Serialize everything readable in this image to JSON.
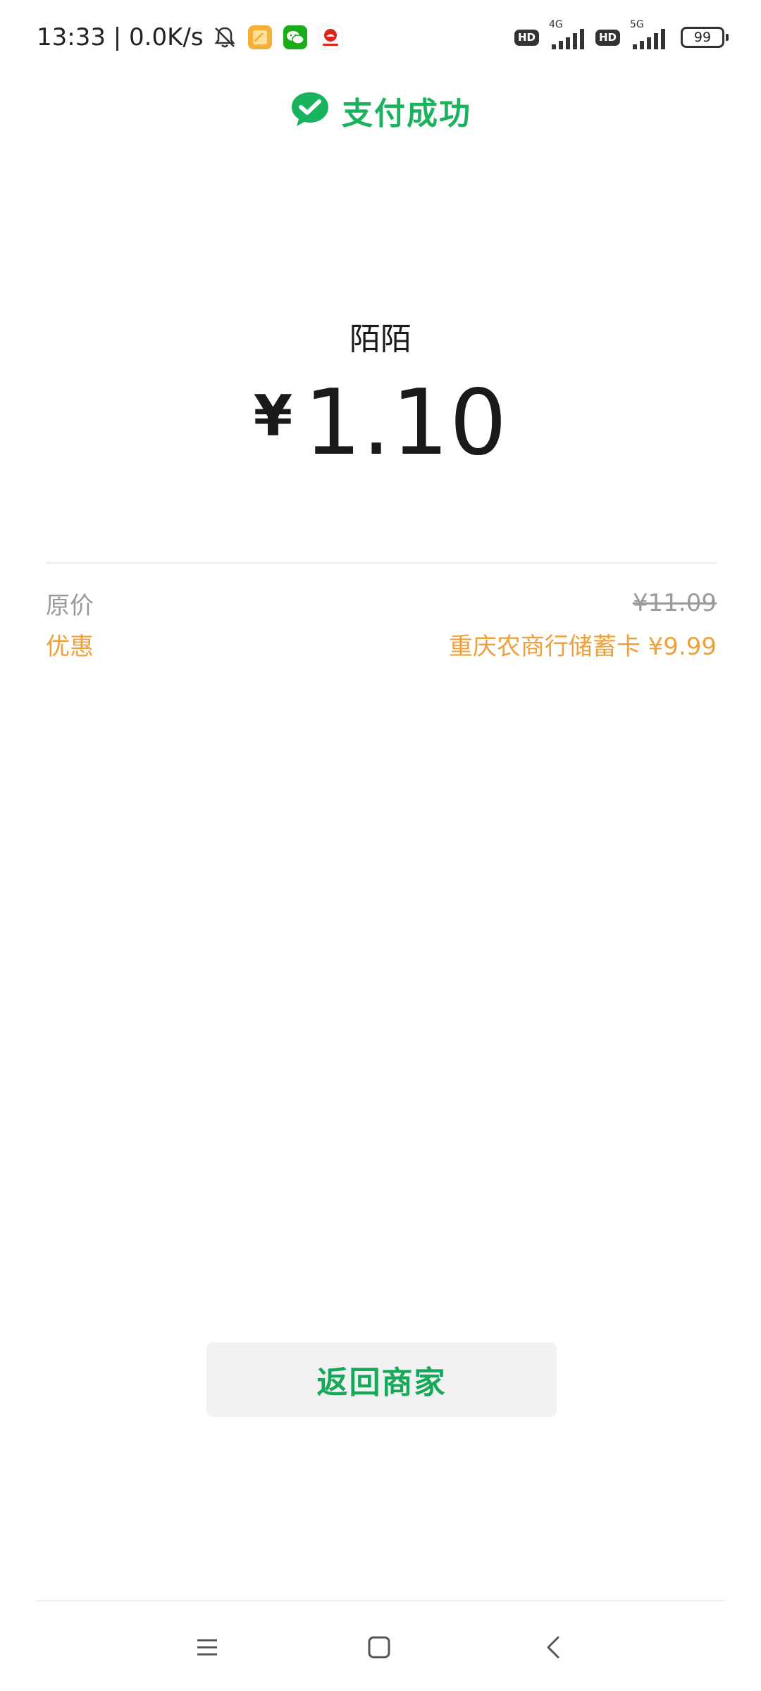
{
  "status_bar": {
    "time_and_speed": "13:33 | 0.0K/s",
    "network_1": "4G",
    "network_2": "5G",
    "hd_label": "HD",
    "battery": "99",
    "icons": [
      "silent-bell-icon",
      "notes-app-icon",
      "wechat-icon",
      "app-notification-icon",
      "signal-icon",
      "battery-icon"
    ]
  },
  "header": {
    "title": "支付成功",
    "icon": "wechat-pay-check-icon",
    "accent_color": "#19b25d"
  },
  "payment": {
    "merchant": "陌陌",
    "currency_symbol": "¥",
    "amount": "1.10"
  },
  "details": {
    "original_label": "原价",
    "original_value": "¥11.09",
    "discount_label": "优惠",
    "discount_value": "重庆农商行储蓄卡 ¥9.99",
    "discount_color": "#f0a03a"
  },
  "actions": {
    "back_label": "返回商家"
  },
  "nav": {
    "icons": [
      "menu-icon",
      "home-icon",
      "back-icon"
    ]
  }
}
